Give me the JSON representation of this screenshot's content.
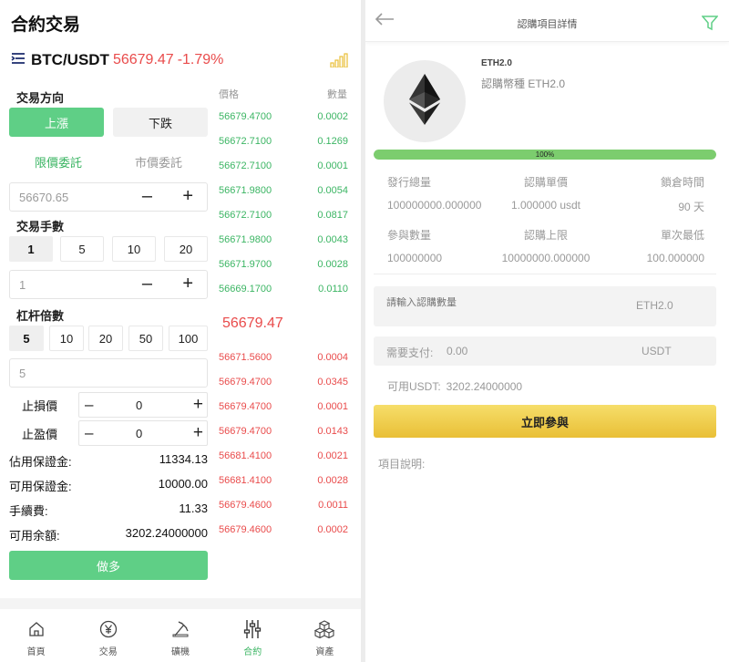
{
  "left": {
    "title": "合約交易",
    "pair": "BTC/USDT",
    "pair_price": "56679.47",
    "pair_change": "-1.79%",
    "direction_label": "交易方向",
    "btn_up": "上漲",
    "btn_down": "下跌",
    "tab_limit": "限價委託",
    "tab_market": "市價委託",
    "price_value": "56670.65",
    "lots_label": "交易手數",
    "lots_options": [
      "1",
      "5",
      "10",
      "20"
    ],
    "lots_value": "1",
    "leverage_label": "杠杆倍數",
    "leverage_options": [
      "5",
      "10",
      "20",
      "50",
      "100"
    ],
    "leverage_value": "5",
    "stop_loss_label": "止損價",
    "stop_loss_value": "0",
    "take_profit_label": "止盈價",
    "take_profit_value": "0",
    "summary": [
      {
        "label": "佔用保證金:",
        "value": "11334.13"
      },
      {
        "label": "可用保證金:",
        "value": "10000.00"
      },
      {
        "label": "手續費:",
        "value": "11.33"
      },
      {
        "label": "可用余額:",
        "value": "3202.24000000"
      }
    ],
    "btn_long": "做多",
    "orderbook": {
      "price_header": "價格",
      "qty_header": "數量",
      "buy": [
        {
          "price": "56679.4700",
          "qty": "0.0002"
        },
        {
          "price": "56672.7100",
          "qty": "0.1269"
        },
        {
          "price": "56672.7100",
          "qty": "0.0001"
        },
        {
          "price": "56671.9800",
          "qty": "0.0054"
        },
        {
          "price": "56672.7100",
          "qty": "0.0817"
        },
        {
          "price": "56671.9800",
          "qty": "0.0043"
        },
        {
          "price": "56671.9700",
          "qty": "0.0028"
        },
        {
          "price": "56669.1700",
          "qty": "0.0110"
        }
      ],
      "mid_price": "56679.47",
      "sell": [
        {
          "price": "56671.5600",
          "qty": "0.0004"
        },
        {
          "price": "56679.4700",
          "qty": "0.0345"
        },
        {
          "price": "56679.4700",
          "qty": "0.0001"
        },
        {
          "price": "56679.4700",
          "qty": "0.0143"
        },
        {
          "price": "56681.4100",
          "qty": "0.0021"
        },
        {
          "price": "56681.4100",
          "qty": "0.0028"
        },
        {
          "price": "56679.4600",
          "qty": "0.0011"
        },
        {
          "price": "56679.4600",
          "qty": "0.0002"
        }
      ]
    },
    "nav": [
      {
        "label": "首頁",
        "icon": "home-icon"
      },
      {
        "label": "交易",
        "icon": "yen-icon"
      },
      {
        "label": "礦機",
        "icon": "mining-icon"
      },
      {
        "label": "合約",
        "icon": "sliders-icon"
      },
      {
        "label": "資產",
        "icon": "cubes-icon"
      }
    ]
  },
  "right": {
    "header_title": "認購項目詳情",
    "coin_name": "ETH2.0",
    "coin_sub": "認購幣種 ETH2.0",
    "progress_percent": 100,
    "progress_text": "100%",
    "stats_row1_labels": [
      "發行總量",
      "認購單價",
      "鎖倉時間"
    ],
    "stats_row1_values": [
      "100000000.000000",
      "1.000000 usdt",
      "90 天"
    ],
    "stats_row2_labels": [
      "參與數量",
      "認購上限",
      "單次最低"
    ],
    "stats_row2_values": [
      "100000000",
      "10000000.000000",
      "100.000000"
    ],
    "input_placeholder": "請輸入認購數量",
    "input_unit": "ETH2.0",
    "pay_label": "需要支付:",
    "pay_value": "0.00",
    "pay_unit": "USDT",
    "avail_label": "可用USDT:",
    "avail_value": "3202.24000000",
    "join_button": "立即參與",
    "desc_label": "項目說明:",
    "colors": {
      "green": "#5fcf86",
      "red": "#e94b4b",
      "gold": "#e9bf36"
    }
  }
}
